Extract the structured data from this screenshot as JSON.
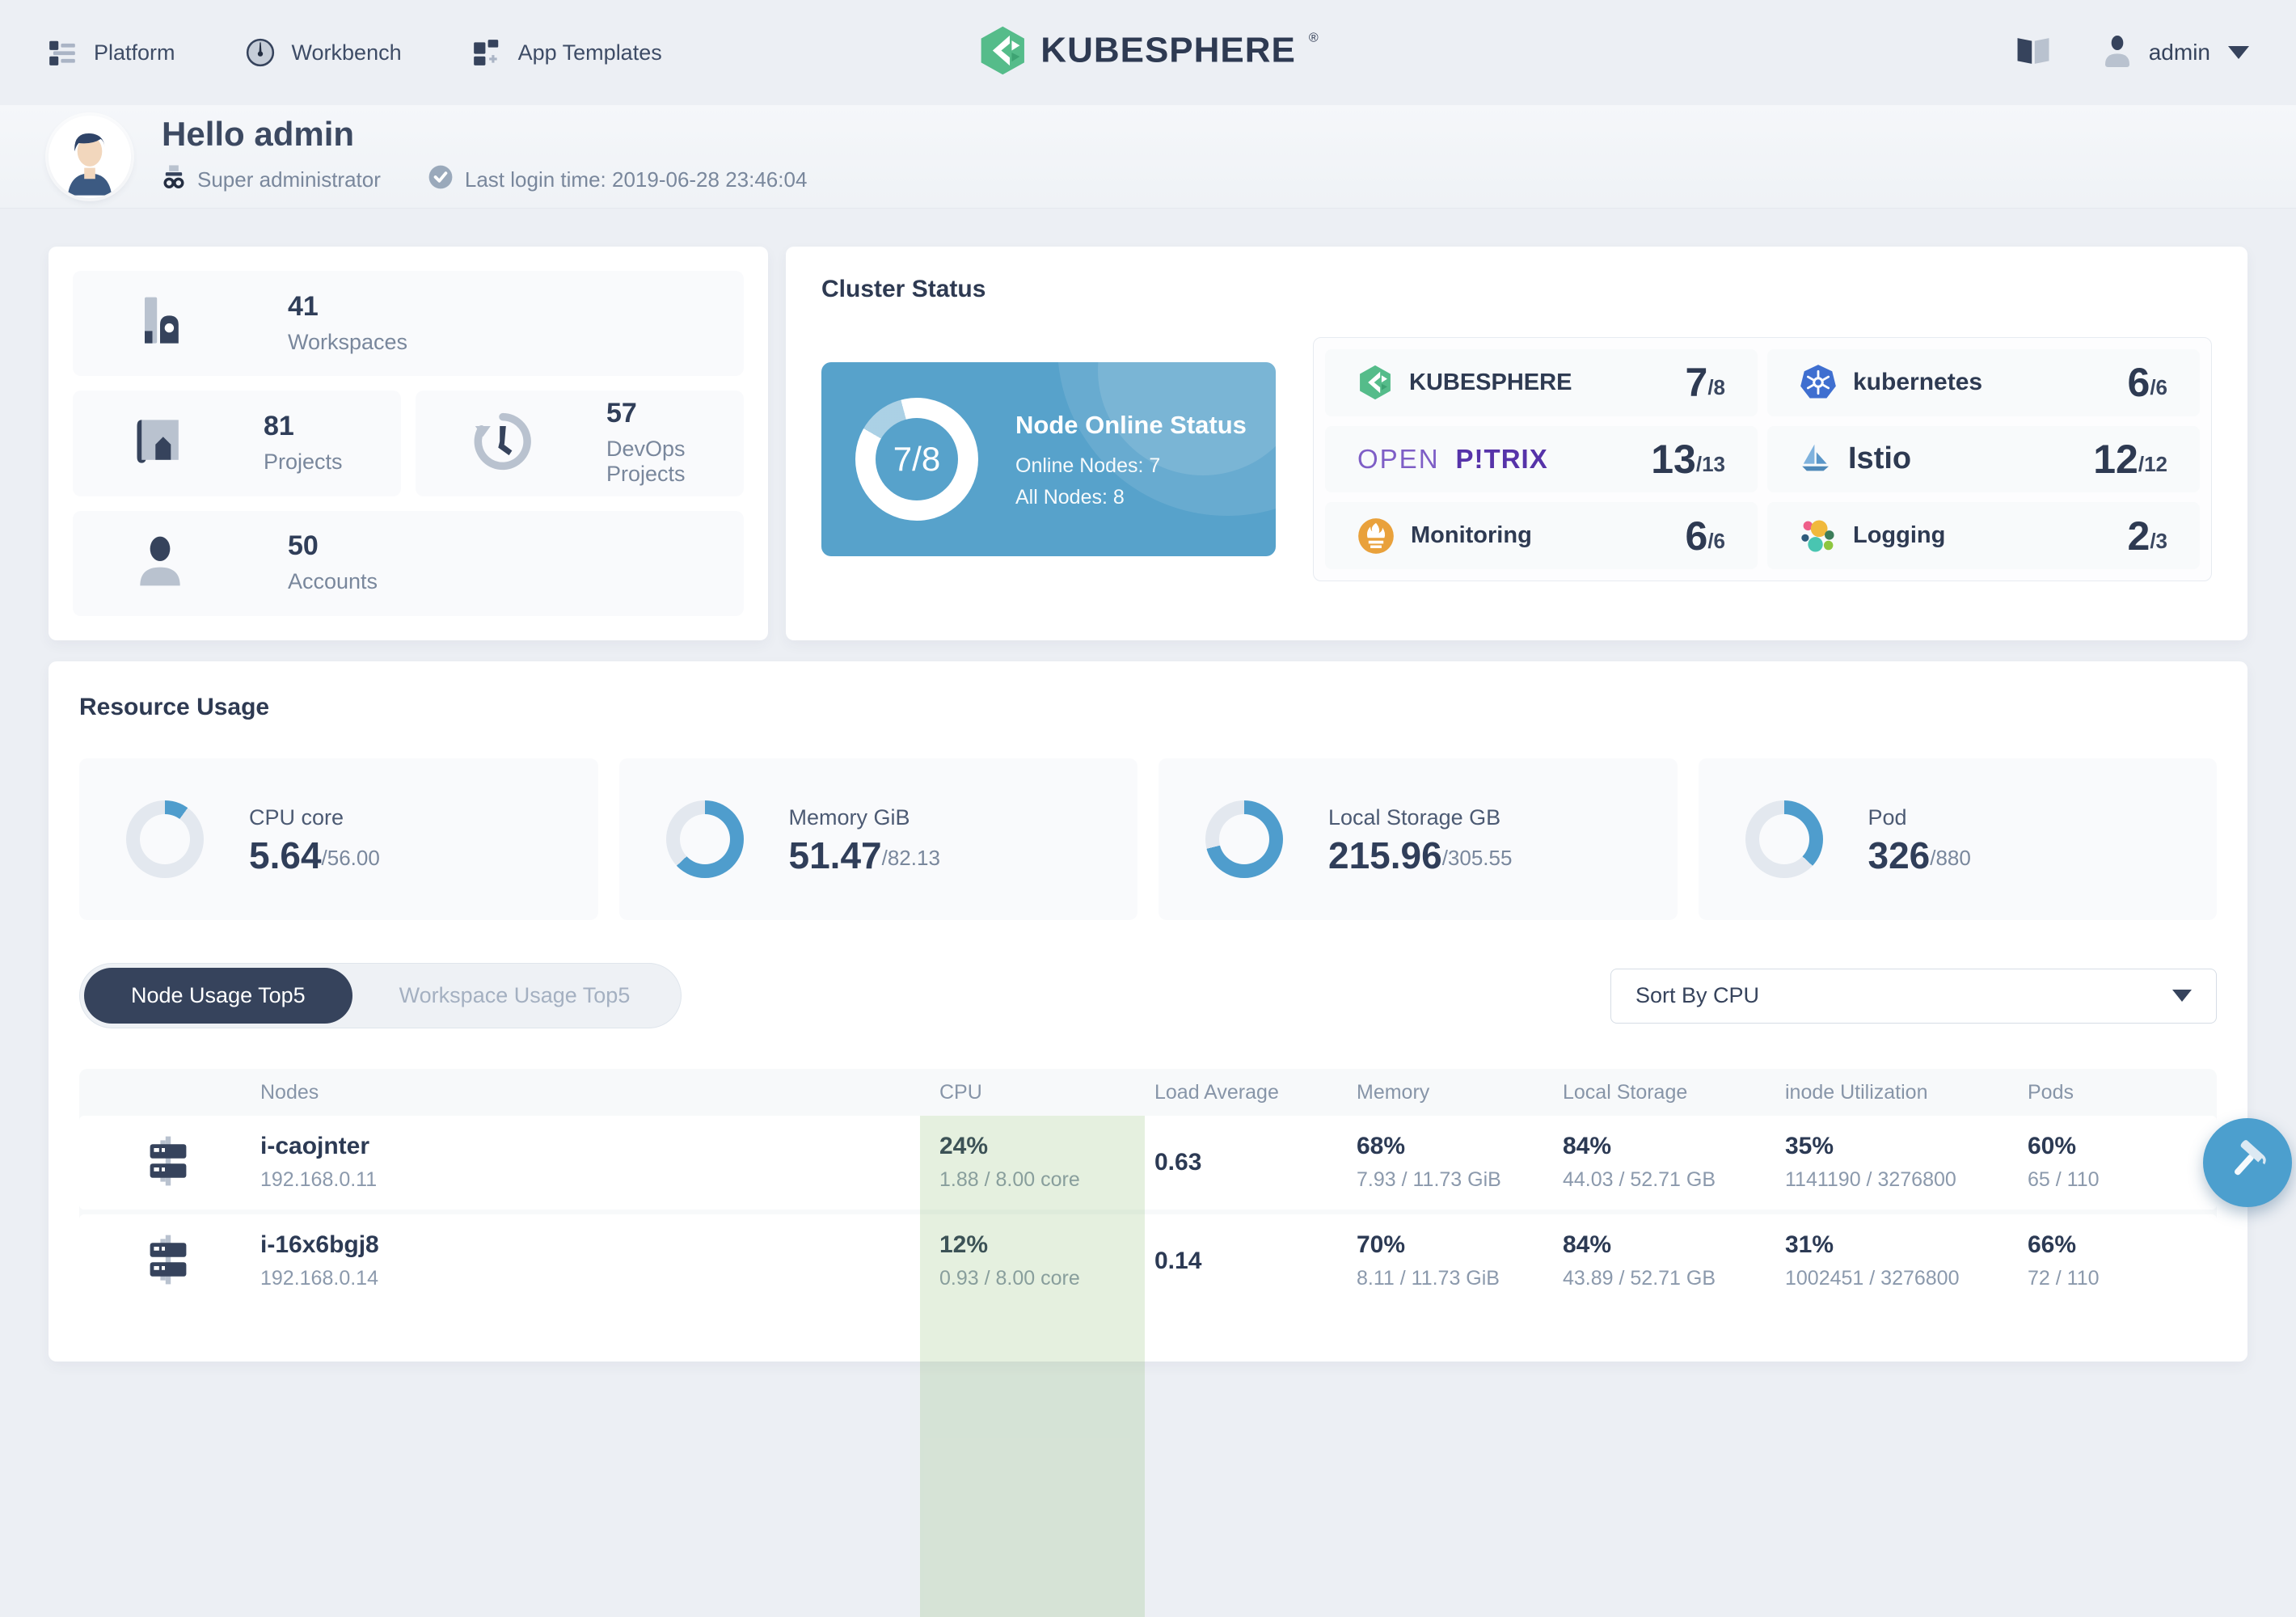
{
  "colors": {
    "brand_green": "#55bc8a",
    "accent_blue": "#57a2cb",
    "navy": "#36435c",
    "cpu_column_highlight": "#e3efde"
  },
  "nav": {
    "items": [
      {
        "label": "Platform"
      },
      {
        "label": "Workbench"
      },
      {
        "label": "App Templates"
      }
    ],
    "brand": "KUBESPHERE",
    "brand_reg": "®",
    "user": {
      "name": "admin"
    }
  },
  "header": {
    "greeting": "Hello admin",
    "role": "Super administrator",
    "last_login": "Last login time: 2019-06-28 23:46:04"
  },
  "stats": {
    "workspaces": {
      "count": "41",
      "label": "Workspaces"
    },
    "projects": {
      "count": "81",
      "label": "Projects"
    },
    "devops": {
      "count": "57",
      "label": "DevOps Projects"
    },
    "accounts": {
      "count": "50",
      "label": "Accounts"
    }
  },
  "cluster": {
    "title": "Cluster Status",
    "node_status": {
      "fraction": "7/8",
      "title": "Node Online Status",
      "online": "Online Nodes: 7",
      "all": "All Nodes: 8",
      "offline_percent": 12.5
    },
    "services": [
      {
        "name": "KUBESPHERE",
        "value": "7",
        "total": "/8"
      },
      {
        "name": "kubernetes",
        "value": "6",
        "total": "/6"
      },
      {
        "name_light": "OPEN",
        "name_bold": "P!TRIX",
        "value": "13",
        "total": "/13"
      },
      {
        "name": "Istio",
        "value": "12",
        "total": "/12"
      },
      {
        "name": "Monitoring",
        "value": "6",
        "total": "/6"
      },
      {
        "name": "Logging",
        "value": "2",
        "total": "/3"
      }
    ]
  },
  "resource": {
    "title": "Resource Usage",
    "metrics": [
      {
        "label": "CPU core",
        "used": "5.64",
        "total": "/56.00",
        "percent": 10
      },
      {
        "label": "Memory GiB",
        "used": "51.47",
        "total": "/82.13",
        "percent": 63
      },
      {
        "label": "Local Storage GB",
        "used": "215.96",
        "total": "/305.55",
        "percent": 71
      },
      {
        "label": "Pod",
        "used": "326",
        "total": "/880",
        "percent": 37
      }
    ],
    "tabs": [
      {
        "label": "Node Usage Top5"
      },
      {
        "label": "Workspace Usage Top5"
      }
    ],
    "sort": {
      "value": "Sort By CPU"
    }
  },
  "table": {
    "columns": [
      "Nodes",
      "CPU",
      "Load Average",
      "Memory",
      "Local Storage",
      "inode Utilization",
      "Pods"
    ],
    "rows": [
      {
        "name": "i-caojnter",
        "ip": "192.168.0.11",
        "cpu": {
          "percent": "24%",
          "detail": "1.88 / 8.00 core"
        },
        "load": "0.63",
        "memory": {
          "percent": "68%",
          "detail": "7.93 / 11.73 GiB"
        },
        "storage": {
          "percent": "84%",
          "detail": "44.03 / 52.71 GB"
        },
        "inode": {
          "percent": "35%",
          "detail": "1141190 / 3276800"
        },
        "pods": {
          "percent": "60%",
          "detail": "65 / 110"
        }
      },
      {
        "name": "i-16x6bgj8",
        "ip": "192.168.0.14",
        "cpu": {
          "percent": "12%",
          "detail": "0.93 / 8.00 core"
        },
        "load": "0.14",
        "memory": {
          "percent": "70%",
          "detail": "8.11 / 11.73 GiB"
        },
        "storage": {
          "percent": "84%",
          "detail": "43.89 / 52.71 GB"
        },
        "inode": {
          "percent": "31%",
          "detail": "1002451 / 3276800"
        },
        "pods": {
          "percent": "66%",
          "detail": "72 / 110"
        }
      }
    ]
  }
}
